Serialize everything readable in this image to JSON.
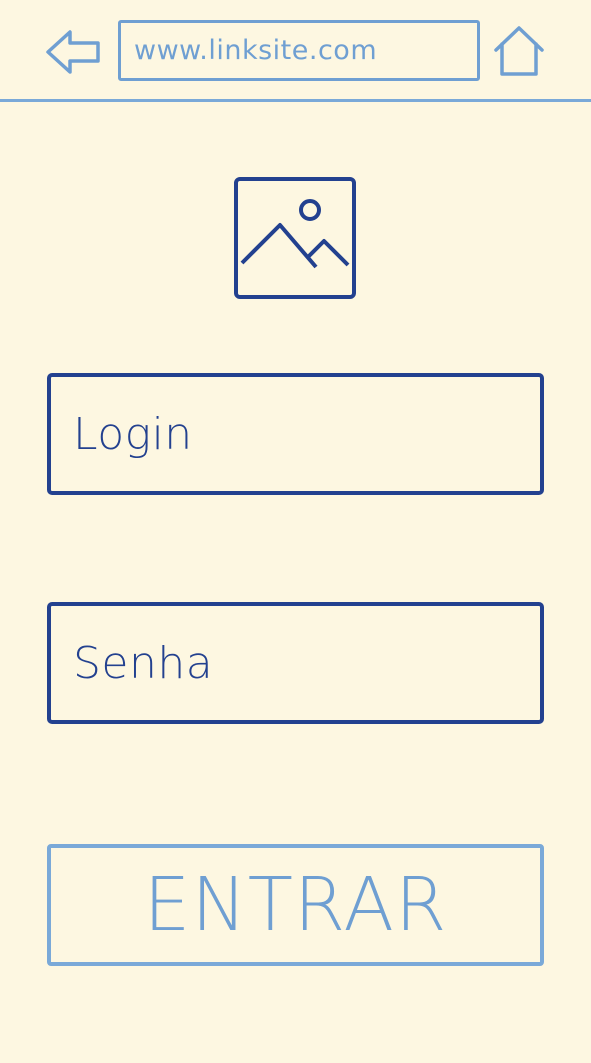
{
  "browser": {
    "url": "www.linksite.com",
    "back_icon": "arrow-left-icon",
    "home_icon": "home-icon"
  },
  "logo": {
    "icon": "image-placeholder-icon"
  },
  "form": {
    "login_placeholder": "Login",
    "password_placeholder": "Senha",
    "submit_label": "ENTRAR"
  },
  "colors": {
    "background": "#fdf7e1",
    "primary_dark_blue": "#23418f",
    "light_blue": "#7aa9d8"
  }
}
